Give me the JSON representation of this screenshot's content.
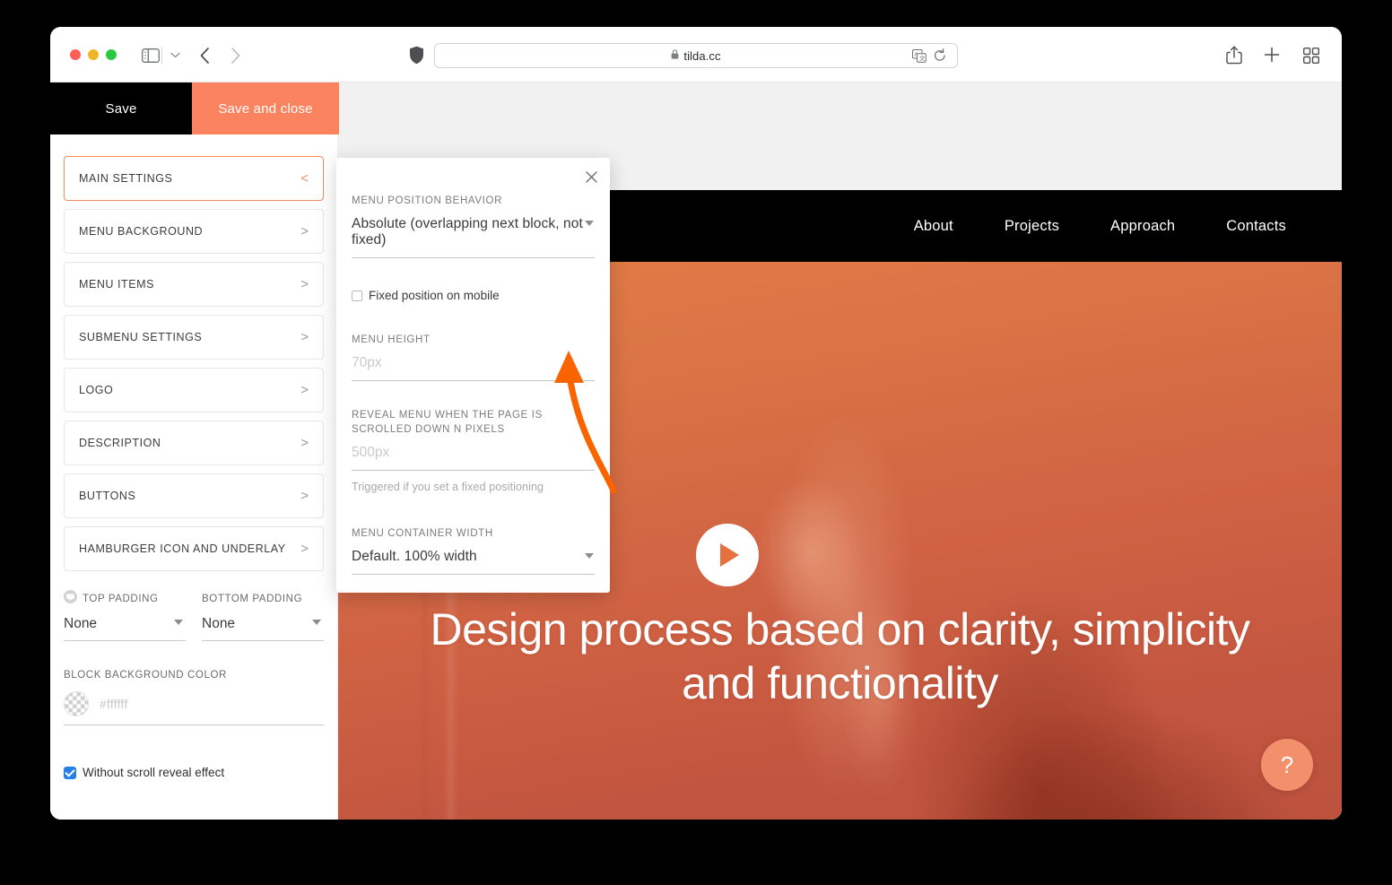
{
  "browser": {
    "traffic_lights": [
      "close",
      "minimize",
      "maximize"
    ],
    "sidebar_toggle_icon": "sidebar-icon",
    "sidebar_chevron_icon": "chevron-down-icon",
    "back_icon": "chevron-left-icon",
    "forward_icon": "chevron-right-icon",
    "shield_icon": "shield-icon",
    "url": "tilda.cc",
    "lock_icon": "lock-icon",
    "translate_icon": "translate-icon",
    "reload_icon": "reload-icon",
    "share_icon": "share-icon",
    "new_tab_icon": "plus-icon",
    "tab_overview_icon": "grid-icon"
  },
  "editor_topbar": {
    "save_label": "Save",
    "save_and_close_label": "Save and close",
    "save_bg": "#000000",
    "save_and_close_bg": "#fc8360"
  },
  "settings_panel": {
    "accordion": [
      {
        "label": "MAIN SETTINGS",
        "chevron": "<",
        "active": true
      },
      {
        "label": "MENU BACKGROUND",
        "chevron": ">",
        "active": false
      },
      {
        "label": "MENU ITEMS",
        "chevron": ">",
        "active": false
      },
      {
        "label": "SUBMENU SETTINGS",
        "chevron": ">",
        "active": false
      },
      {
        "label": "LOGO",
        "chevron": ">",
        "active": false
      },
      {
        "label": "DESCRIPTION",
        "chevron": ">",
        "active": false
      },
      {
        "label": "BUTTONS",
        "chevron": ">",
        "active": false
      },
      {
        "label": "HAMBURGER ICON AND UNDERLAY",
        "chevron": ">",
        "active": false
      }
    ],
    "top_padding": {
      "label": "TOP PADDING",
      "value": "None",
      "icon": "monitor-icon"
    },
    "bottom_padding": {
      "label": "BOTTOM PADDING",
      "value": "None"
    },
    "block_background_color": {
      "label": "BLOCK BACKGROUND COLOR",
      "placeholder": "#ffffff",
      "swatch": "transparent-checker"
    },
    "scroll_reveal": {
      "label": "Without scroll reveal effect",
      "checked": true,
      "checkbox_color": "#2680eb"
    }
  },
  "popup": {
    "close_icon": "close-icon",
    "menu_position_behavior": {
      "label": "MENU POSITION BEHAVIOR",
      "value": "Absolute (overlapping next block, not fixed)"
    },
    "fixed_position_mobile": {
      "label": "Fixed position on mobile",
      "checked": false
    },
    "menu_height": {
      "label": "MENU HEIGHT",
      "placeholder": "70px"
    },
    "reveal_menu": {
      "label": "REVEAL MENU WHEN THE PAGE IS SCROLLED DOWN N PIXELS",
      "placeholder": "500px",
      "hint": "Triggered if you set a fixed positioning"
    },
    "menu_container_width": {
      "label": "MENU CONTAINER WIDTH",
      "value": "Default. 100% width"
    }
  },
  "annotation": {
    "arrow_color": "#fa6400",
    "points_to": "menu-position-behavior-select"
  },
  "preview": {
    "nav_links": [
      "About",
      "Projects",
      "Approach",
      "Contacts"
    ],
    "nav_bg": "#000000",
    "hero_title": "Design process based on clarity, simplicity and functionality",
    "play_button_icon": "play-icon",
    "help_button_label": "?",
    "help_button_bg": "#f3906c"
  }
}
